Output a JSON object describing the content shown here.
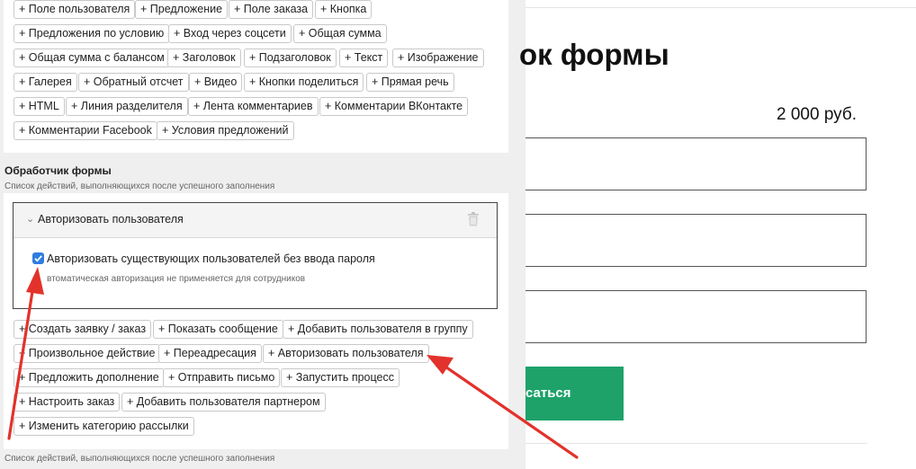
{
  "palette": {
    "buttons": [
      "+ Поле пользователя",
      "+ Предложение",
      "+ Поле заказа",
      "+ Кнопка",
      "+ Предложения по условию",
      "+ Вход через соцсети",
      "+ Общая сумма",
      "+ Общая сумма с балансом",
      "+ Заголовок",
      "+ Подзаголовок",
      "+ Текст",
      "+ Изображение",
      "+ Галерея",
      "+ Обратный отсчет",
      "+ Видео",
      "+ Кнопки поделиться",
      "+ Прямая речь",
      "+ HTML",
      "+ Линия разделителя",
      "+ Лента комментариев",
      "+ Комментарии ВКонтакте",
      "+ Комментарии Facebook",
      "+ Условия предложений"
    ]
  },
  "handler": {
    "title": "Обработчик формы",
    "subtitle": "Список действий, выполняющихся после успешного заполнения",
    "footer_subtitle": "Список действий, выполняющихся после успешного заполнения"
  },
  "action_card": {
    "title": "Авторизовать пользователя",
    "checkbox_label": "Авторизовать существующих пользователей без ввода пароля",
    "checkbox_checked": true,
    "hint": "втоматическая авторизация не применяется для сотрудников"
  },
  "actions": {
    "buttons": [
      "+ Создать заявку / заказ",
      "+ Показать сообщение",
      "+ Добавить пользователя в группу",
      "+ Произвольное действие",
      "+ Переадресация",
      "+ Авторизовать пользователя",
      "+ Предложить дополнение",
      "+ Отправить письмо",
      "+ Запустить процесс",
      "+ Настроить заказ",
      "+ Добавить пользователя партнером",
      "+ Изменить категорию рассылки"
    ]
  },
  "preview": {
    "title": "ок формы",
    "price": "2 000 руб.",
    "submit_label": "саться"
  },
  "colors": {
    "accent_green": "#1ea26a",
    "arrow_red": "#e2322b",
    "checkbox_blue": "#2f7dde"
  }
}
